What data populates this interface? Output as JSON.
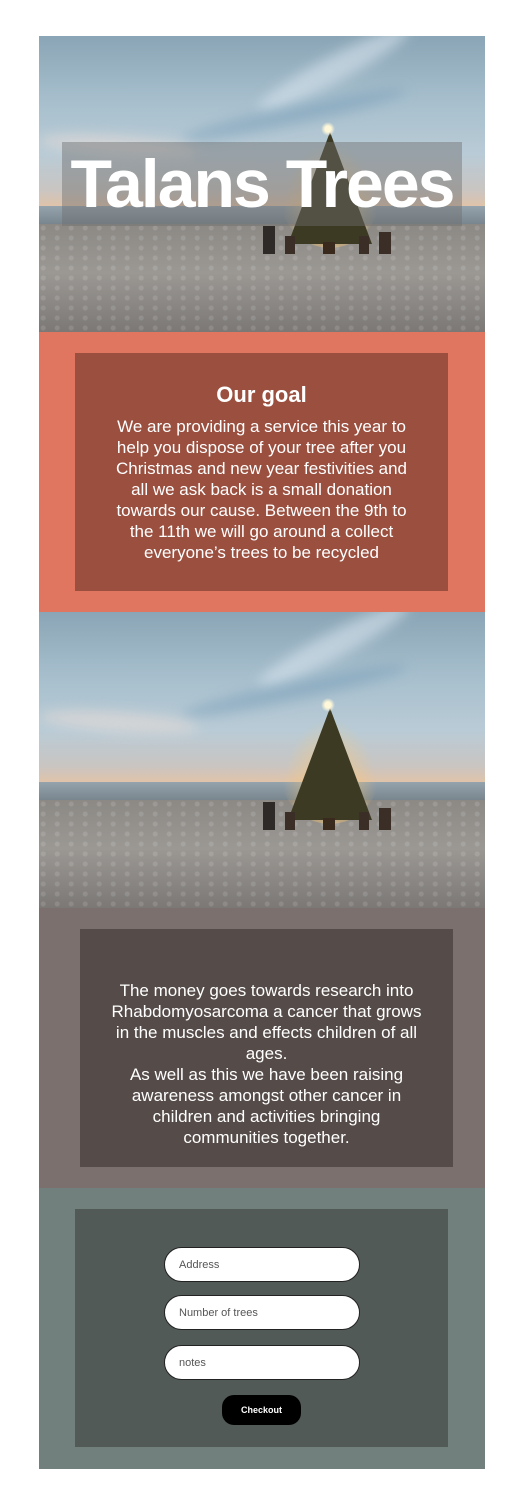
{
  "header": {
    "title": "Talans Trees",
    "hero_image": "beach-christmas-tree-photo"
  },
  "goal": {
    "heading": "Our goal",
    "text": "We are providing a service this year to help you dispose of your tree after you Christmas and new year festivities and all we ask back is a small donation towards our cause. Between the 9th to the 11th we will go around a collect everyone’s trees to be recycled"
  },
  "secondary_image": "beach-christmas-tree-photo",
  "money": {
    "text_1": "The money goes towards research into Rhabdomyosarcoma a cancer that grows in the muscles and effects children of all ages.",
    "text_2": "As well as this we have been raising awareness amongst other cancer in children and activities bringing communities together."
  },
  "form": {
    "address_placeholder": "Address",
    "trees_placeholder": "Number of trees",
    "notes_placeholder": "notes",
    "checkout_label": "Checkout"
  },
  "colors": {
    "goal_bg": "#e07660",
    "goal_card": "#9a4f3f",
    "money_bg": "#7b706d",
    "money_card": "#554c49",
    "form_bg": "#72807d",
    "form_card": "#515a57",
    "button": "#000000"
  }
}
